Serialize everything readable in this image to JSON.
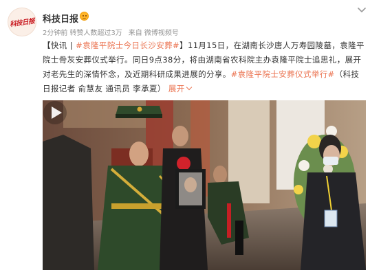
{
  "post": {
    "author": {
      "name": "科技日报",
      "avatar_text": "科技日报",
      "verified_icon": "vip-smile-icon"
    },
    "meta": {
      "time": "2分钟前",
      "edited": "转赞人数超过3万",
      "source": "来自 微博视频号"
    },
    "more_icon": "chevron-down-icon",
    "text": {
      "prefix": "【快讯 | ",
      "topic1": "#袁隆平院士今日长沙安葬#",
      "middle": "】11月15日，在湖南长沙唐人万寿园陵墓，袁隆平院士骨灰安葬仪式举行。同日9点38分，将由湖南省农科院主办袁隆平院士追思礼，展开对老先生的深情怀念，及近期科研成果进展的分享。",
      "topic2": "#袁隆平院士安葬仪式举行#",
      "suffix": "（科技日报记者 俞慧友 通讯员 李承夏）",
      "expand": "展开"
    },
    "video": {
      "play_icon": "play-icon"
    }
  },
  "colors": {
    "topic": "#eb7350",
    "text": "#333333",
    "meta": "#939393",
    "badge": "#ffb52b"
  }
}
